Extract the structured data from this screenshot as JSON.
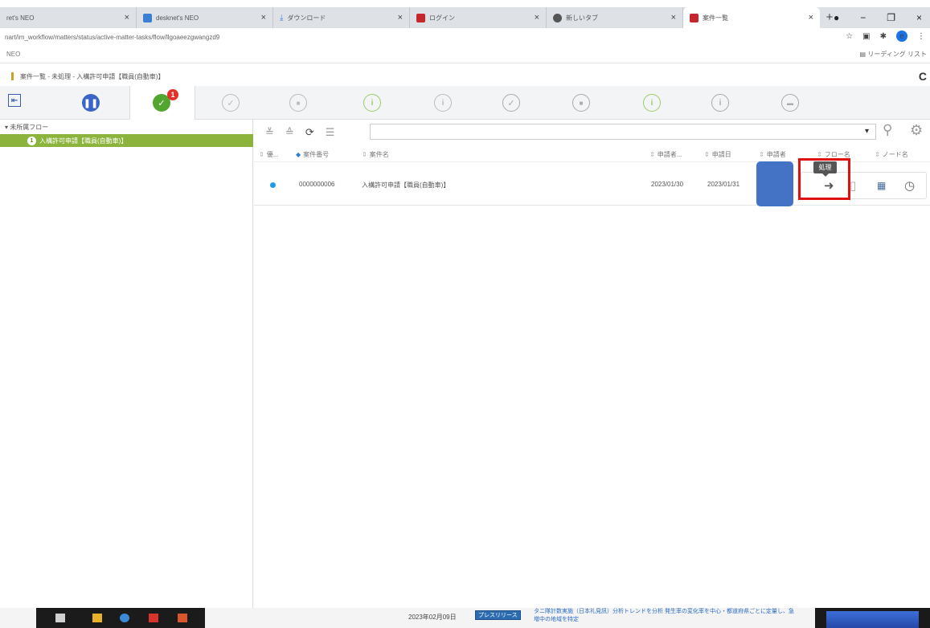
{
  "browser": {
    "tabs": [
      {
        "title": "ret's NEO",
        "fav_color": "#dee1e6"
      },
      {
        "title": "desknet's NEO",
        "fav_color": "#3b7fd4"
      },
      {
        "title": "ダウンロード",
        "fav_color": "#3b7fd4"
      },
      {
        "title": "ログイン",
        "fav_color": "#c8262d"
      },
      {
        "title": "新しいタブ",
        "fav_color": "#555555"
      },
      {
        "title": "案件一覧",
        "fav_color": "#c8262d"
      }
    ],
    "new_tab": "+",
    "address": "nart/im_workflow/matters/status/active-matter-tasks/flow/llgoaeezgwangzd9",
    "ext_label": "e",
    "bookmark_label": "NEO",
    "reading_list": "リーディング リスト"
  },
  "page": {
    "breadcrumb": "案件一覧 - 未処理 - 入構許可申請【職員(自動車)】",
    "active_badge": "1"
  },
  "tree": {
    "root": "未所属フロー",
    "item_count": "1",
    "item_label": "入構許可申請【職員(自動車)】"
  },
  "table": {
    "headers": [
      "優...",
      "案件番号",
      "案件名",
      "申請者...",
      "申請日",
      "申請者",
      "フロー名",
      "ノード名"
    ],
    "rows": [
      {
        "number": "0000000006",
        "name": "入構許可申請【職員(自動車)】",
        "date1": "2023/01/30",
        "date2": "2023/01/31"
      }
    ]
  },
  "tooltip": "処理",
  "taskbar": {
    "news_date": "2023年02月09日",
    "news_tag": "プレスリリース",
    "news_text": "タニ隊計数実施（日本礼見訊）分析トレンドを分析 発生率の変化率を中心・都道府県ごとに定量し、急増中の地域を特定"
  },
  "colors": {
    "accent_green": "#8cb43c",
    "badge_red": "#e2312a",
    "highlight_red": "#e01010",
    "dot_blue": "#1e9be4"
  }
}
